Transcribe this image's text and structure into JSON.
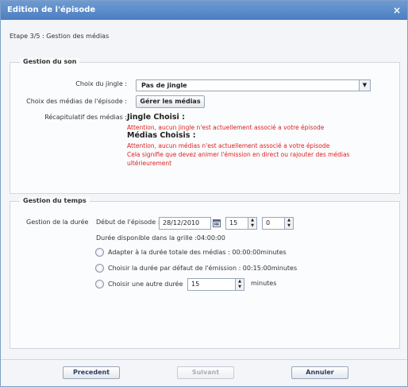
{
  "dialog": {
    "title": "Edition de l'épisode",
    "close_glyph": "×",
    "step": "Etape 3/5 : Gestion des médias"
  },
  "sound": {
    "legend": "Gestion du son",
    "jingle_label": "Choix du jingle :",
    "jingle_value": "Pas de jingle",
    "media_label": "Choix des médias de l'épisode :",
    "media_button": "Gérer les médias",
    "recap_label": "Récapitulatif des médias :",
    "jingle_heading": "Jingle Choisi :",
    "jingle_warning": "Attention, aucun jingle n'est actuellement associé a votre épisode",
    "media_heading": "Médias Choisis :",
    "media_warning_1": "Attention, aucun médias n'est actuellement associé a votre épisode",
    "media_warning_2": "Cela signifie que devez animer l'émission en direct ou rajouter des médias",
    "media_warning_3": "ultérieurement"
  },
  "time": {
    "legend": "Gestion du temps",
    "duration_label": "Gestion de la durée",
    "start_label": "Début de l'épisode :",
    "date_value": "28/12/2010",
    "hour_value": "15",
    "minute_value": "0",
    "available": "Durée disponible dans la grille :04:00:00",
    "option_1": "Adapter à la durée totale des médias : 00:00:00minutes",
    "option_2": "Choisir la durée par défaut de l'émission : 00:15:00minutes",
    "option_3": "Choisir une autre durée",
    "custom_value": "15",
    "custom_unit": "minutes"
  },
  "footer": {
    "previous": "Precedent",
    "next": "Suivant",
    "cancel": "Annuler"
  },
  "colors": {
    "title_bar": "#5a8ccb",
    "warning": "#e02020"
  },
  "icons": {
    "close": "close-icon",
    "dropdown": "chevron-down-icon",
    "calendar": "calendar-icon",
    "spinner": "spinner-arrows-icon"
  }
}
